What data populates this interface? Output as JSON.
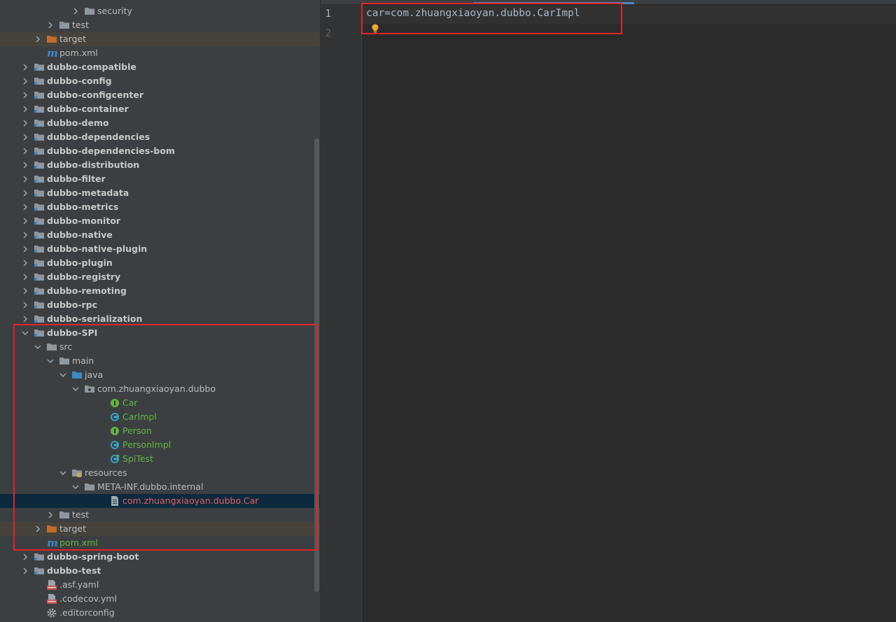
{
  "project_tree": {
    "rows": [
      {
        "label": "security",
        "depth": 5,
        "icon": "folder-icon",
        "chevron": "collapsed",
        "style": ""
      },
      {
        "label": "test",
        "depth": 3,
        "icon": "folder-icon",
        "chevron": "collapsed",
        "style": ""
      },
      {
        "label": "target",
        "depth": 2,
        "icon": "folder-excluded-icon",
        "chevron": "collapsed",
        "style": "hl"
      },
      {
        "label": "pom.xml",
        "depth": 2,
        "icon": "maven-icon",
        "chevron": "none",
        "style": ""
      },
      {
        "label": "dubbo-compatible",
        "depth": 1,
        "icon": "module-icon",
        "chevron": "collapsed",
        "style": "module"
      },
      {
        "label": "dubbo-config",
        "depth": 1,
        "icon": "module-icon",
        "chevron": "collapsed",
        "style": "module"
      },
      {
        "label": "dubbo-configcenter",
        "depth": 1,
        "icon": "module-icon",
        "chevron": "collapsed",
        "style": "module"
      },
      {
        "label": "dubbo-container",
        "depth": 1,
        "icon": "module-icon",
        "chevron": "collapsed",
        "style": "module"
      },
      {
        "label": "dubbo-demo",
        "depth": 1,
        "icon": "module-icon",
        "chevron": "collapsed",
        "style": "module"
      },
      {
        "label": "dubbo-dependencies",
        "depth": 1,
        "icon": "module-icon",
        "chevron": "collapsed",
        "style": "module"
      },
      {
        "label": "dubbo-dependencies-bom",
        "depth": 1,
        "icon": "module-icon",
        "chevron": "collapsed",
        "style": "module"
      },
      {
        "label": "dubbo-distribution",
        "depth": 1,
        "icon": "module-icon",
        "chevron": "collapsed",
        "style": "module"
      },
      {
        "label": "dubbo-filter",
        "depth": 1,
        "icon": "module-icon",
        "chevron": "collapsed",
        "style": "module"
      },
      {
        "label": "dubbo-metadata",
        "depth": 1,
        "icon": "module-icon",
        "chevron": "collapsed",
        "style": "module"
      },
      {
        "label": "dubbo-metrics",
        "depth": 1,
        "icon": "module-icon",
        "chevron": "collapsed",
        "style": "module"
      },
      {
        "label": "dubbo-monitor",
        "depth": 1,
        "icon": "module-icon",
        "chevron": "collapsed",
        "style": "module"
      },
      {
        "label": "dubbo-native",
        "depth": 1,
        "icon": "module-icon",
        "chevron": "collapsed",
        "style": "module"
      },
      {
        "label": "dubbo-native-plugin",
        "depth": 1,
        "icon": "module-icon",
        "chevron": "collapsed",
        "style": "module"
      },
      {
        "label": "dubbo-plugin",
        "depth": 1,
        "icon": "module-icon",
        "chevron": "collapsed",
        "style": "module"
      },
      {
        "label": "dubbo-registry",
        "depth": 1,
        "icon": "module-icon",
        "chevron": "collapsed",
        "style": "module"
      },
      {
        "label": "dubbo-remoting",
        "depth": 1,
        "icon": "module-icon",
        "chevron": "collapsed",
        "style": "module"
      },
      {
        "label": "dubbo-rpc",
        "depth": 1,
        "icon": "module-icon",
        "chevron": "collapsed",
        "style": "module"
      },
      {
        "label": "dubbo-serialization",
        "depth": 1,
        "icon": "module-icon",
        "chevron": "collapsed",
        "style": "module"
      },
      {
        "label": "dubbo-SPI",
        "depth": 1,
        "icon": "module-icon",
        "chevron": "expanded",
        "style": "module"
      },
      {
        "label": "src",
        "depth": 2,
        "icon": "folder-icon",
        "chevron": "expanded",
        "style": ""
      },
      {
        "label": "main",
        "depth": 3,
        "icon": "folder-icon",
        "chevron": "expanded",
        "style": ""
      },
      {
        "label": "java",
        "depth": 4,
        "icon": "source-folder-icon",
        "chevron": "expanded",
        "style": ""
      },
      {
        "label": "com.zhuangxiaoyan.dubbo",
        "depth": 5,
        "icon": "package-icon",
        "chevron": "expanded",
        "style": ""
      },
      {
        "label": "Car",
        "depth": 7,
        "icon": "interface-icon",
        "chevron": "none",
        "style": "green"
      },
      {
        "label": "CarImpl",
        "depth": 7,
        "icon": "class-icon",
        "chevron": "none",
        "style": "green"
      },
      {
        "label": "Person",
        "depth": 7,
        "icon": "interface-icon",
        "chevron": "none",
        "style": "green"
      },
      {
        "label": "PersonImpl",
        "depth": 7,
        "icon": "class-icon",
        "chevron": "none",
        "style": "green"
      },
      {
        "label": "SpiTest",
        "depth": 7,
        "icon": "test-class-icon",
        "chevron": "none",
        "style": "green"
      },
      {
        "label": "resources",
        "depth": 4,
        "icon": "resources-folder-icon",
        "chevron": "expanded",
        "style": ""
      },
      {
        "label": "META-INF.dubbo.internal",
        "depth": 5,
        "icon": "folder-icon",
        "chevron": "expanded",
        "style": ""
      },
      {
        "label": "com.zhuangxiaoyan.dubbo.Car",
        "depth": 7,
        "icon": "text-file-icon",
        "chevron": "none",
        "style": "sel red"
      },
      {
        "label": "test",
        "depth": 3,
        "icon": "folder-icon",
        "chevron": "collapsed",
        "style": ""
      },
      {
        "label": "target",
        "depth": 2,
        "icon": "folder-excluded-icon",
        "chevron": "collapsed",
        "style": "hl"
      },
      {
        "label": "pom.xml",
        "depth": 2,
        "icon": "maven-icon",
        "chevron": "none",
        "style": "green"
      },
      {
        "label": "dubbo-spring-boot",
        "depth": 1,
        "icon": "module-icon",
        "chevron": "collapsed",
        "style": "module"
      },
      {
        "label": "dubbo-test",
        "depth": 1,
        "icon": "module-icon",
        "chevron": "collapsed",
        "style": "module"
      },
      {
        "label": ".asf.yaml",
        "depth": 2,
        "icon": "yaml-icon",
        "chevron": "none",
        "style": ""
      },
      {
        "label": ".codecov.yml",
        "depth": 2,
        "icon": "yaml-icon",
        "chevron": "none",
        "style": ""
      },
      {
        "label": ".editorconfig",
        "depth": 2,
        "icon": "gear-icon",
        "chevron": "none",
        "style": ""
      }
    ]
  },
  "editor": {
    "line_numbers": [
      "1",
      "2"
    ],
    "lines": [
      "car=com.zhuangxiaoyan.dubbo.CarImpl",
      ""
    ],
    "intention_icon": "lightbulb-icon"
  },
  "colors": {
    "tree_bg": "#3c3f41",
    "editor_bg": "#2b2b2b",
    "selection": "#0d293e",
    "excluded_highlight": "#45433c",
    "green_text": "#62b543",
    "red_text": "#e06060",
    "annotation_red": "#e0242b",
    "folder_gray": "#8e979f",
    "source_blue": "#3d89c5",
    "excluded_orange": "#c46a2b"
  }
}
